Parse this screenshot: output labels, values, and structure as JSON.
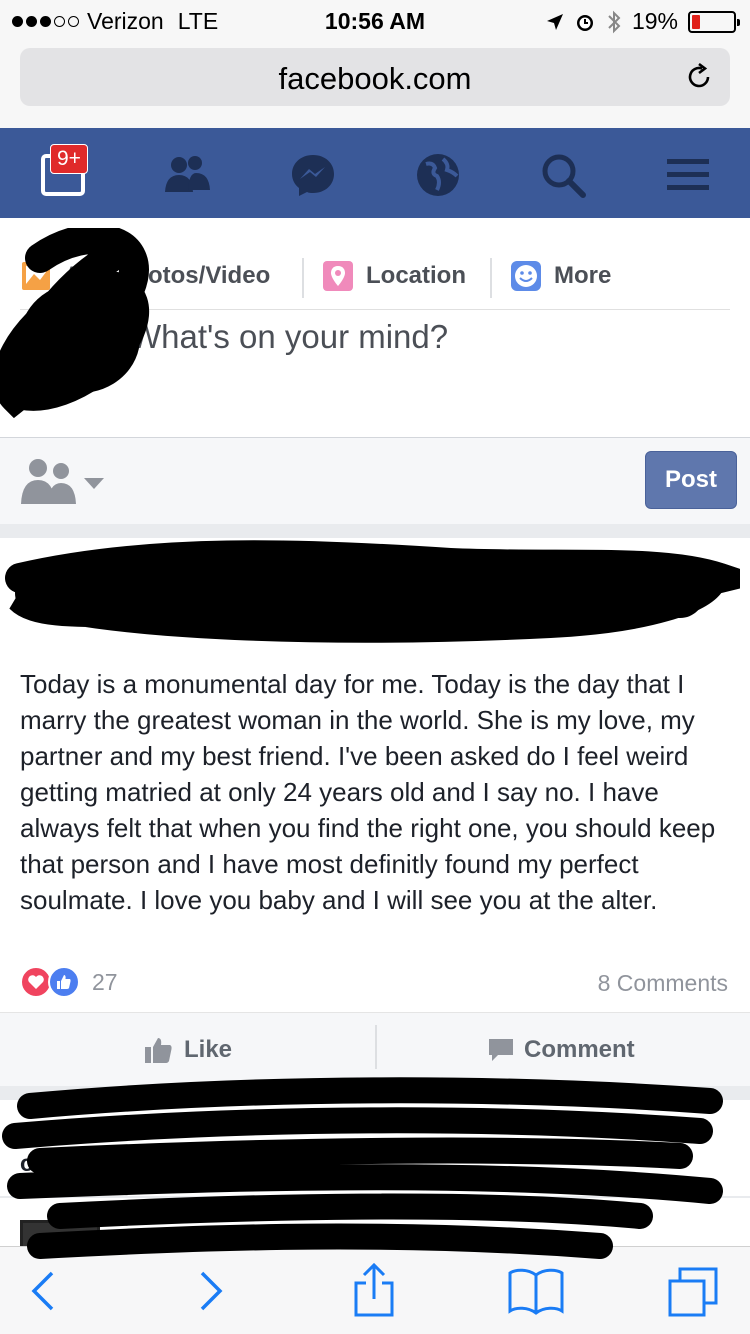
{
  "status_bar": {
    "carrier": "Verizon",
    "network": "LTE",
    "time": "10:56 AM",
    "battery_percent": "19%",
    "battery_level": 0.19,
    "battery_color": "#e0201a"
  },
  "browser": {
    "url": "facebook.com",
    "reload_icon": "reload-icon"
  },
  "fb_nav": {
    "background_color": "#3b5998",
    "notification_badge": "9+",
    "icons": [
      "news-feed-icon",
      "friends-icon",
      "messenger-icon",
      "globe-icon",
      "search-icon",
      "menu-icon"
    ]
  },
  "composer": {
    "actions": [
      {
        "label": "Add Photos/Video",
        "icon": "photo-icon"
      },
      {
        "label": "Location",
        "icon": "location-pin-icon"
      },
      {
        "label": "More",
        "icon": "smiley-icon"
      }
    ],
    "placeholder": "What's on your mind?",
    "post_button": "Post",
    "audience_icon": "friends-audience-icon"
  },
  "story": {
    "text": "Today is a monumental day for me. Today is the day that I marry the greatest woman in the world. She is my love, my partner and my best friend. I've been asked do I feel weird getting matried at only 24 years old and I say no. I have always felt that when you find the right one, you should keep that person and I have most definitly found my perfect soulmate. I love you baby and I will see you at the alter.",
    "reaction_count": "27",
    "comment_count": "8 Comments",
    "like_label": "Like",
    "comment_label": "Comment"
  },
  "comments_preview": {
    "likes_line_fragment": "others like"
  },
  "toolbar": {
    "buttons": [
      "back-icon",
      "forward-icon",
      "share-icon",
      "bookmarks-icon",
      "tabs-icon"
    ],
    "accent_color": "#1a7cf5"
  }
}
